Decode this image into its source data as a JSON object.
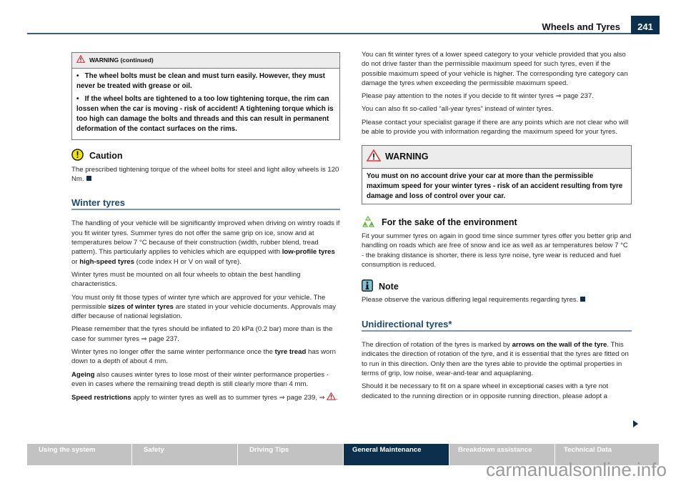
{
  "header": {
    "title": "Wheels and Tyres",
    "page_number": "241"
  },
  "left": {
    "warning_continued": {
      "title": "WARNING (continued)",
      "bullets": [
        "The wheel bolts must be clean and must turn easily. However, they must never be treated with grease or oil.",
        "If the wheel bolts are tightened to a too low tightening torque, the rim can lossen when the car is moving - risk of accident! A tightening torque which is too high can damage the bolts and threads and this can result in permanent deformation of the contact surfaces on the rims."
      ]
    },
    "caution": {
      "title": "Caution",
      "text": "The prescribed tightening torque of the wheel bolts for steel and light alloy wheels is 120 Nm."
    },
    "winter_heading": "Winter tyres",
    "p1": {
      "a": "The handling of your vehicle will be significantly improved when driving on wintry roads if you fit winter tyres. Summer tyres do not offer the same grip on ice, snow and at temperatures below 7 °C because of their construction (width, rubber blend, tread pattern). This particularly applies to vehicles which are equipped with ",
      "b1": "low-profile tyres",
      "c": " or ",
      "b2": "high-speed tyres",
      "d": " (code index H or V on wall of tyre)."
    },
    "p2": "Winter tyres must be mounted on all four wheels to obtain the best handling characteristics.",
    "p3": {
      "a": "You must only fit those types of winter tyre which are approved for your vehicle. The permissible ",
      "b": "sizes of winter tyres",
      "c": " are stated in your vehicle documents. Approvals may differ because of national legislation."
    },
    "p4": "Please remember that the tyres should be inflated to 20 kPa (0.2 bar) more than is the case for summer tyres ⇒ page 237.",
    "p5": {
      "a": "Winter tyres no longer offer the same winter performance once the ",
      "b": "tyre tread",
      "c": " has worn down to a depth of about 4 mm."
    },
    "p6": {
      "b": "Ageing",
      "a": " also causes winter tyres to lose most of their winter performance properties - even in cases where the remaining tread depth is still clearly more than 4 mm."
    },
    "p7": {
      "b": "Speed restrictions",
      "a": " apply to winter tyres as well as to summer tyres ⇒ page 239, ⇒ ",
      "end": "."
    }
  },
  "right": {
    "p1": "You can fit winter tyres of a lower speed category to your vehicle provided that you also do not drive faster than the permissible maximum speed for such tyres, even if the possible maximum speed of your vehicle is higher. The corresponding tyre category can damage the tyres when exceeding the permissible maximum speed.",
    "p2": "Please pay attention to the notes if you decide to fit winter tyres ⇒ page 237.",
    "p3": "You can also fit so-called “all-year tyres” instead of winter tyres.",
    "p4": "Please contact your specialist garage if there are any points which are not clear who will be able to provide you with information regarding the maximum speed for your tyres.",
    "warning": {
      "title": "WARNING",
      "text": "You must on no account drive your car at more than the permissible maximum speed for your winter tyres - risk of an accident resulting from tyre damage and loss of control over your car."
    },
    "environment": {
      "title": "For the sake of the environment",
      "text": "Fit your summer tyres on again in good time since summer tyres offer you better grip and handling on roads which are free of snow and ice as well as ar temperatures below 7 °C - the braking distance is shorter, there is less tyre noise, tyre wear is reduced and fuel consumption is reduced."
    },
    "note": {
      "title": "Note",
      "text": "Please observe the various differing legal requirements regarding tyres."
    },
    "uni_heading": "Unidirectional tyres*",
    "p5": {
      "a": "The direction of rotation of the tyres is marked by ",
      "b": "arrows on the wall of the tyre",
      "c": ". This indicates the direction of rotation of the tyre, and it is essential that the tyres are fitted on to run in this direction. Only then are the tyres able to provide the optimal properties in terms of grip, low noise, wear-and-tear and aquaplaning."
    },
    "p6": "Should it be necessary to fit on a spare wheel in exceptional cases with a tyre not dedicated to the running direction or in opposite running direction, please adopt a"
  },
  "nav": {
    "items": [
      {
        "label": "Using the system",
        "active": false
      },
      {
        "label": "Safety",
        "active": false
      },
      {
        "label": "Driving Tips",
        "active": false
      },
      {
        "label": "General Maintenance",
        "active": true
      },
      {
        "label": "Breakdown assistance",
        "active": false
      },
      {
        "label": "Technical Data",
        "active": false
      }
    ]
  },
  "watermark": "carmanualsonline.info",
  "colors": {
    "brand_navy": "#0c2f4e",
    "heading_blue": "#1d4a6e",
    "warning_red": "#e0303a",
    "caution_yellow": "#f2e500",
    "env_green": "#5cb83a",
    "note_teal": "#7fc4d6"
  }
}
